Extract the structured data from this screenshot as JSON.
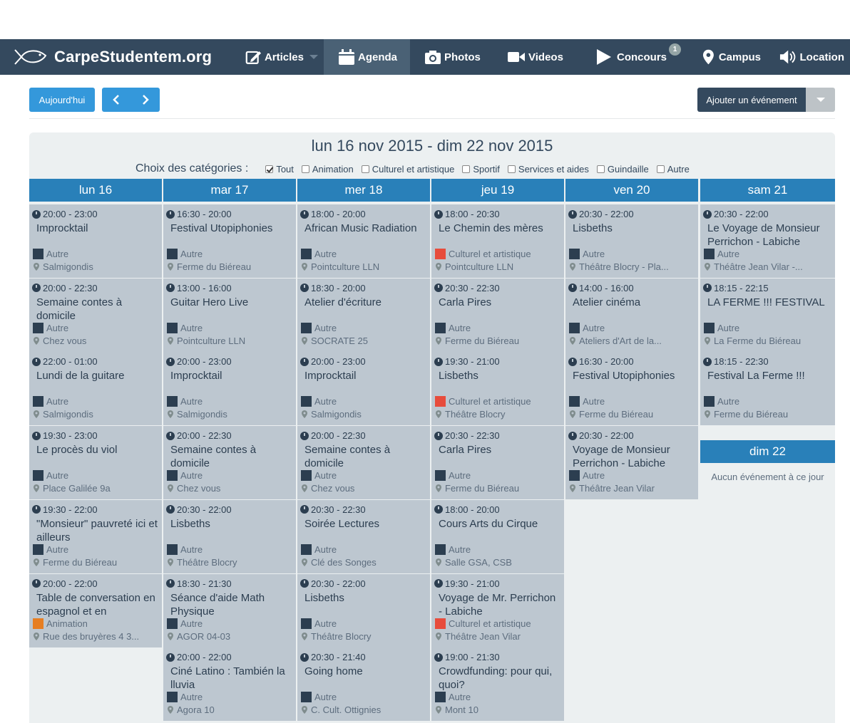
{
  "nav": {
    "brand": "CarpeStudentem.org",
    "items": [
      {
        "label": "Articles",
        "icon": "edit-icon"
      },
      {
        "label": "Agenda",
        "icon": "calendar-icon"
      },
      {
        "label": "Photos",
        "icon": "camera-icon"
      },
      {
        "label": "Videos",
        "icon": "video-icon"
      },
      {
        "label": "Concours",
        "icon": "play-icon",
        "badge": "1"
      },
      {
        "label": "Campus",
        "icon": "map-marker-icon"
      },
      {
        "label": "Location",
        "icon": "volume-icon"
      }
    ]
  },
  "toolbar": {
    "today": "Aujourd'hui",
    "add_event": "Ajouter un événement"
  },
  "calendar": {
    "title": "lun 16 nov 2015 - dim 22 nov 2015",
    "categories_label": "Choix des catégories :",
    "categories": [
      {
        "label": "Tout",
        "checked": true
      },
      {
        "label": "Animation",
        "checked": false
      },
      {
        "label": "Culturel et artistique",
        "checked": false
      },
      {
        "label": "Sportif",
        "checked": false
      },
      {
        "label": "Services et aides",
        "checked": false
      },
      {
        "label": "Guindaille",
        "checked": false
      },
      {
        "label": "Autre",
        "checked": false
      }
    ],
    "category_colors": {
      "Autre": "#2c3e50",
      "Culturel et artistique": "#e74c3c",
      "Animation": "#e67e22"
    },
    "days": [
      {
        "label": "lun 16",
        "events": [
          {
            "time": "20:00 - 23:00",
            "title": "Improcktail",
            "category": "Autre",
            "location": "Salmigondis"
          },
          {
            "time": "20:00 - 22:30",
            "title": "Semaine contes à domicile",
            "category": "Autre",
            "location": "Chez vous"
          },
          {
            "time": "22:00 - 01:00",
            "title": "Lundi de la guitare",
            "category": "Autre",
            "location": "Salmigondis"
          },
          {
            "time": "19:30 - 23:00",
            "title": "Le procès du viol",
            "category": "Autre",
            "location": "Place Galilée 9a"
          },
          {
            "time": "19:30 - 22:00",
            "title": "\"Monsieur\" pauvreté ici et ailleurs",
            "category": "Autre",
            "location": "Ferme du Biéreau"
          },
          {
            "time": "20:00 - 22:00",
            "title": "Table de conversation en espagnol et en",
            "category": "Animation",
            "location": "Rue des bruyères 4 3..."
          }
        ]
      },
      {
        "label": "mar 17",
        "events": [
          {
            "time": "16:30 - 20:00",
            "title": "Festival Utopiphonies",
            "category": "Autre",
            "location": "Ferme du Biéreau"
          },
          {
            "time": "13:00 - 16:00",
            "title": "Guitar Hero Live",
            "category": "Autre",
            "location": "Pointculture LLN"
          },
          {
            "time": "20:00 - 23:00",
            "title": "Improcktail",
            "category": "Autre",
            "location": "Salmigondis"
          },
          {
            "time": "20:00 - 22:30",
            "title": "Semaine contes à domicile",
            "category": "Autre",
            "location": "Chez vous"
          },
          {
            "time": "20:30 - 22:00",
            "title": "Lisbeths",
            "category": "Autre",
            "location": "Théâtre Blocry"
          },
          {
            "time": "18:30 - 21:30",
            "title": "Séance d'aide Math Physique",
            "category": "Autre",
            "location": "AGOR 04-03"
          },
          {
            "time": "20:00 - 22:00",
            "title": "Ciné Latino : También la lluvia",
            "category": "Autre",
            "location": "Agora 10"
          }
        ]
      },
      {
        "label": "mer 18",
        "events": [
          {
            "time": "18:00 - 20:00",
            "title": "African Music Radiation",
            "category": "Autre",
            "location": "Pointculture LLN"
          },
          {
            "time": "18:30 - 20:00",
            "title": "Atelier d'écriture",
            "category": "Autre",
            "location": "SOCRATE 25"
          },
          {
            "time": "20:00 - 23:00",
            "title": "Improcktail",
            "category": "Autre",
            "location": "Salmigondis"
          },
          {
            "time": "20:00 - 22:30",
            "title": "Semaine contes à domicile",
            "category": "Autre",
            "location": "Chez vous"
          },
          {
            "time": "20:30 - 22:30",
            "title": "Soirée Lectures",
            "category": "Autre",
            "location": "Clé des Songes"
          },
          {
            "time": "20:30 - 22:00",
            "title": "Lisbeths",
            "category": "Autre",
            "location": "Théâtre Blocry"
          },
          {
            "time": "20:30 - 21:40",
            "title": "Going home",
            "category": "Autre",
            "location": "C. Cult. Ottignies"
          }
        ]
      },
      {
        "label": "jeu 19",
        "events": [
          {
            "time": "18:00 - 20:30",
            "title": "Le Chemin des mères",
            "category": "Culturel et artistique",
            "location": "Pointculture LLN"
          },
          {
            "time": "20:30 - 22:30",
            "title": "Carla Pires",
            "category": "Autre",
            "location": "Ferme du Biéreau"
          },
          {
            "time": "19:30 - 21:00",
            "title": "Lisbeths",
            "category": "Culturel et artistique",
            "location": "Théâtre Blocry"
          },
          {
            "time": "20:30 - 22:30",
            "title": "Carla Pires",
            "category": "Autre",
            "location": "Ferme du Biéreau"
          },
          {
            "time": "18:00 - 20:00",
            "title": "Cours Arts du Cirque",
            "category": "Autre",
            "location": "Salle GSA, CSB"
          },
          {
            "time": "19:30 - 21:00",
            "title": "Voyage de Mr. Perrichon - Labiche",
            "category": "Culturel et artistique",
            "location": "Théâtre Jean Vilar"
          },
          {
            "time": "19:00 - 21:30",
            "title": "Crowdfunding: pour qui, quoi?",
            "category": "Autre",
            "location": "Mont 10"
          }
        ]
      },
      {
        "label": "ven 20",
        "events": [
          {
            "time": "20:30 - 22:00",
            "title": "Lisbeths",
            "category": "Autre",
            "location": "Théâtre Blocry - Pla..."
          },
          {
            "time": "14:00 - 16:00",
            "title": "Atelier cinéma",
            "category": "Autre",
            "location": "Ateliers d'Art de la..."
          },
          {
            "time": "16:30 - 20:00",
            "title": "Festival Utopiphonies",
            "category": "Autre",
            "location": "Ferme du Biéreau"
          },
          {
            "time": "20:30 - 22:00",
            "title": "Voyage de Monsieur Perrichon - Labiche",
            "category": "Autre",
            "location": "Théâtre Jean Vilar"
          }
        ]
      },
      {
        "label": "sam 21",
        "events": [
          {
            "time": "20:30 - 22:00",
            "title": "Le Voyage de Monsieur Perrichon - Labiche",
            "category": "Autre",
            "location": "Théâtre Jean Vilar -..."
          },
          {
            "time": "18:15 - 22:15",
            "title": "LA FERME !!! FESTIVAL",
            "category": "Autre",
            "location": "La Ferme du Biéreau"
          },
          {
            "time": "18:15 - 22:30",
            "title": "Festival La Ferme !!!",
            "category": "Autre",
            "location": "Ferme du Biéreau"
          }
        ]
      }
    ],
    "sunday": {
      "label": "dim 22",
      "empty": "Aucun événement à ce jour"
    }
  }
}
